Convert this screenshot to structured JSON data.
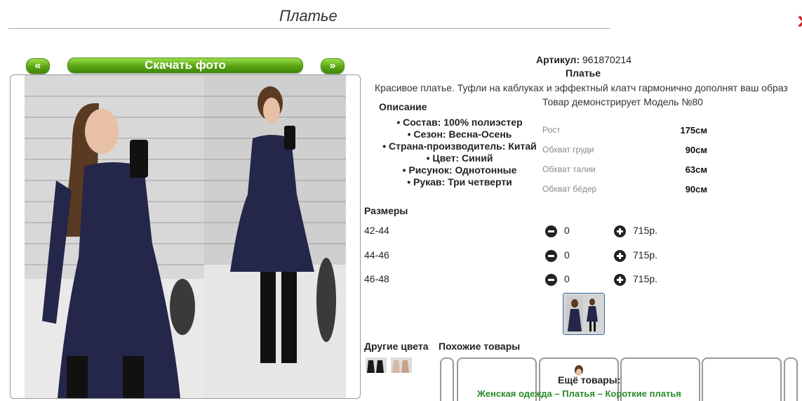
{
  "page": {
    "title": "Платье"
  },
  "gallery": {
    "prev_label": "«",
    "next_label": "»",
    "download_label": "Скачать фото"
  },
  "product": {
    "article_label": "Артикул:",
    "article_value": "961870214",
    "name": "Платье",
    "description": "Красивое платье. Туфли на каблуках и эффектный клатч гармонично дополнят ваш образ",
    "description_heading": "Описание",
    "properties": [
      "Состав: 100% полиэстер",
      "Сезон: Весна-Осень",
      "Страна-производитель: Китай",
      "Цвет: Синий",
      "Рисунок: Однотонные",
      "Рукав: Три четверти"
    ]
  },
  "model": {
    "caption": "Товар демонстрирует Модель №80",
    "measurements": [
      {
        "label": "Рост",
        "value": "175см"
      },
      {
        "label": "Обхват груди",
        "value": "90см"
      },
      {
        "label": "Обхват талии",
        "value": "63см"
      },
      {
        "label": "Обхват бёдер",
        "value": "90см"
      }
    ]
  },
  "sizes": {
    "heading": "Размеры",
    "rows": [
      {
        "size": "42-44",
        "qty": "0",
        "price": "715р."
      },
      {
        "size": "44-46",
        "qty": "0",
        "price": "715р."
      },
      {
        "size": "46-48",
        "qty": "0",
        "price": "715р."
      }
    ]
  },
  "other_colors": {
    "heading": "Другие цвета"
  },
  "similar": {
    "heading": "Похожие товары"
  },
  "more": {
    "heading": "Ещё товары:",
    "links_text": "Женская одежда – Платья – Короткие платья"
  },
  "colors": {
    "accent_green": "#5aa514",
    "link_green": "#2a8a2a",
    "dress_navy": "#24264a"
  }
}
